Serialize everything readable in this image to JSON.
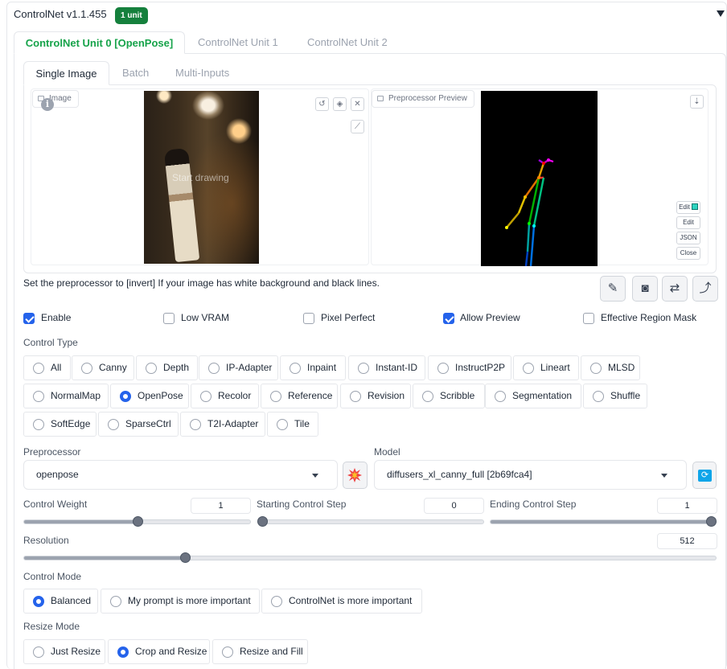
{
  "header": {
    "title": "ControlNet v1.1.455",
    "badge": "1 unit"
  },
  "unit_tabs": [
    "ControlNet Unit 0 [OpenPose]",
    "ControlNet Unit 1",
    "ControlNet Unit 2"
  ],
  "image_tabs": [
    "Single Image",
    "Batch",
    "Multi-Inputs"
  ],
  "image_panel": {
    "image_label": "Image",
    "start_drawing": "Start drawing",
    "info_icon": "i",
    "preview_label": "Preprocessor Preview",
    "preview_buttons": [
      "Edit",
      "Edit",
      "JSON",
      "Close"
    ]
  },
  "hint": "Set the preprocessor to [invert] If your image has white background and black lines.",
  "checkboxes": [
    {
      "label": "Enable",
      "checked": true
    },
    {
      "label": "Low VRAM",
      "checked": false
    },
    {
      "label": "Pixel Perfect",
      "checked": false
    },
    {
      "label": "Allow Preview",
      "checked": true
    },
    {
      "label": "Effective Region Mask",
      "checked": false
    }
  ],
  "control_type": {
    "label": "Control Type",
    "options": [
      "All",
      "Canny",
      "Depth",
      "IP-Adapter",
      "Inpaint",
      "Instant-ID",
      "InstructP2P",
      "Lineart",
      "MLSD",
      "NormalMap",
      "OpenPose",
      "Recolor",
      "Reference",
      "Revision",
      "Scribble",
      "Segmentation",
      "Shuffle",
      "SoftEdge",
      "SparseCtrl",
      "T2I-Adapter",
      "Tile"
    ],
    "selected": "OpenPose"
  },
  "preprocessor": {
    "label": "Preprocessor",
    "value": "openpose"
  },
  "model": {
    "label": "Model",
    "value": "diffusers_xl_canny_full [2b69fca4]"
  },
  "sliders": {
    "control_weight": {
      "label": "Control Weight",
      "value": "1",
      "fraction": 0.5
    },
    "starting_step": {
      "label": "Starting Control Step",
      "value": "0",
      "fraction": 0.0
    },
    "ending_step": {
      "label": "Ending Control Step",
      "value": "1",
      "fraction": 1.0
    },
    "resolution": {
      "label": "Resolution",
      "value": "512",
      "fraction": 0.232
    }
  },
  "control_mode": {
    "label": "Control Mode",
    "options": [
      "Balanced",
      "My prompt is more important",
      "ControlNet is more important"
    ],
    "selected": "Balanced"
  },
  "resize_mode": {
    "label": "Resize Mode",
    "options": [
      "Just Resize",
      "Crop and Resize",
      "Resize and Fill"
    ],
    "selected": "Crop and Resize"
  },
  "colors": {
    "accent": "#2563eb",
    "active_tab": "#16a34a",
    "badge": "#15803d"
  }
}
